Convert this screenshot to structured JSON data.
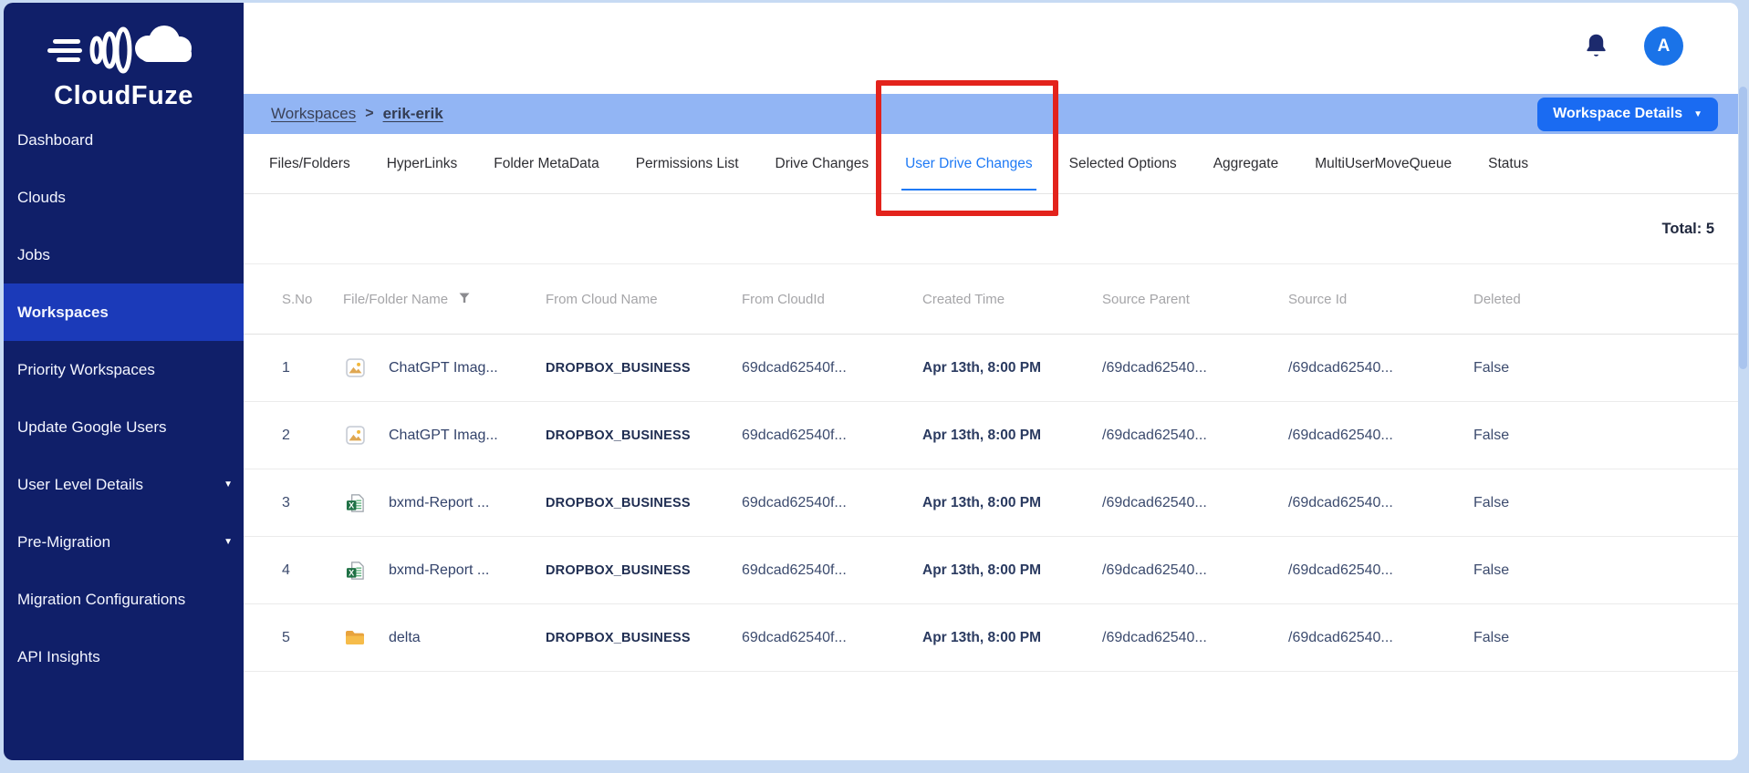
{
  "brand": {
    "name": "CloudFuze"
  },
  "topbar": {
    "avatar_letter": "A"
  },
  "sidebar": {
    "items": [
      {
        "label": "Dashboard"
      },
      {
        "label": "Clouds"
      },
      {
        "label": "Jobs"
      },
      {
        "label": "Workspaces",
        "active": true
      },
      {
        "label": "Priority Workspaces"
      },
      {
        "label": "Update Google Users"
      },
      {
        "label": "User Level Details",
        "caret": true
      },
      {
        "label": "Pre-Migration",
        "caret": true
      },
      {
        "label": "Migration Configurations"
      },
      {
        "label": "API Insights"
      }
    ]
  },
  "breadcrumb": {
    "root": "Workspaces",
    "separator": ">",
    "current": "erik-erik"
  },
  "workspace_details_button": {
    "label": "Workspace Details",
    "caret": "▼"
  },
  "tabs": {
    "items": [
      {
        "label": "Files/Folders"
      },
      {
        "label": "HyperLinks"
      },
      {
        "label": "Folder MetaData"
      },
      {
        "label": "Permissions List"
      },
      {
        "label": "Drive Changes"
      },
      {
        "label": "User Drive Changes",
        "active": true,
        "annotated": true
      },
      {
        "label": "Selected Options"
      },
      {
        "label": "Aggregate"
      },
      {
        "label": "MultiUserMoveQueue"
      },
      {
        "label": "Status"
      }
    ]
  },
  "summary": {
    "total": "Total: 5"
  },
  "table": {
    "columns": [
      {
        "label": "S.No"
      },
      {
        "label": "File/Folder Name",
        "has_filter": true
      },
      {
        "label": "From Cloud Name"
      },
      {
        "label": "From CloudId"
      },
      {
        "label": "Created Time"
      },
      {
        "label": "Source Parent"
      },
      {
        "label": "Source Id"
      },
      {
        "label": "Deleted"
      }
    ],
    "rows": [
      {
        "sno": "1",
        "icon": "image",
        "name": "ChatGPT Imag...",
        "from_cloud_name": "DROPBOX_BUSINESS",
        "from_cloud_id": "69dcad62540f...",
        "created_time": "Apr 13th, 8:00 PM",
        "source_parent": "/69dcad62540...",
        "source_id": "/69dcad62540...",
        "deleted": "False"
      },
      {
        "sno": "2",
        "icon": "image",
        "name": "ChatGPT Imag...",
        "from_cloud_name": "DROPBOX_BUSINESS",
        "from_cloud_id": "69dcad62540f...",
        "created_time": "Apr 13th, 8:00 PM",
        "source_parent": "/69dcad62540...",
        "source_id": "/69dcad62540...",
        "deleted": "False"
      },
      {
        "sno": "3",
        "icon": "excel",
        "name": "bxmd-Report ...",
        "from_cloud_name": "DROPBOX_BUSINESS",
        "from_cloud_id": "69dcad62540f...",
        "created_time": "Apr 13th, 8:00 PM",
        "source_parent": "/69dcad62540...",
        "source_id": "/69dcad62540...",
        "deleted": "False"
      },
      {
        "sno": "4",
        "icon": "excel",
        "name": "bxmd-Report ...",
        "from_cloud_name": "DROPBOX_BUSINESS",
        "from_cloud_id": "69dcad62540f...",
        "created_time": "Apr 13th, 8:00 PM",
        "source_parent": "/69dcad62540...",
        "source_id": "/69dcad62540...",
        "deleted": "False"
      },
      {
        "sno": "5",
        "icon": "folder",
        "name": "delta",
        "from_cloud_name": "DROPBOX_BUSINESS",
        "from_cloud_id": "69dcad62540f...",
        "created_time": "Apr 13th, 8:00 PM",
        "source_parent": "/69dcad62540...",
        "source_id": "/69dcad62540...",
        "deleted": "False"
      }
    ]
  },
  "colors": {
    "sidebar_navy": "#101f69",
    "sidebar_active_blue": "#1b3ab9",
    "breadcrumb_bg": "#92b5f4",
    "accent_button_blue": "#1a6bf2",
    "active_tab_blue": "#1f7af5",
    "avatar_blue": "#1a73e8",
    "annotation_red": "#e3231c"
  }
}
